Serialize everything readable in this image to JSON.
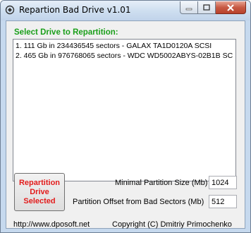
{
  "window": {
    "title": "Repartion Bad Drive v1.01"
  },
  "main": {
    "section_label": "Select Drive to Repartition:",
    "drives": [
      "1. 111 Gb in 234436545 sectors  -  GALAX TA1D0120A SCSI",
      "2. 465 Gb in 976768065 sectors  -  WDC WD5002ABYS-02B1B SC"
    ],
    "repartition_button": {
      "line1": "Repartition",
      "line2": "Drive",
      "line3": "Selected"
    },
    "min_partition": {
      "label": "Minimal Partition Size (Mb)",
      "value": "1024"
    },
    "partition_offset": {
      "label": "Partition Offset from Bad Sectors (Mb)",
      "value": "512"
    }
  },
  "footer": {
    "url": "http://www.dposoft.net",
    "copyright": "Copyright (C) Dmitriy Primochenko"
  },
  "colors": {
    "section_label": "#1a9f1a",
    "button_text": "#e21b1b"
  }
}
